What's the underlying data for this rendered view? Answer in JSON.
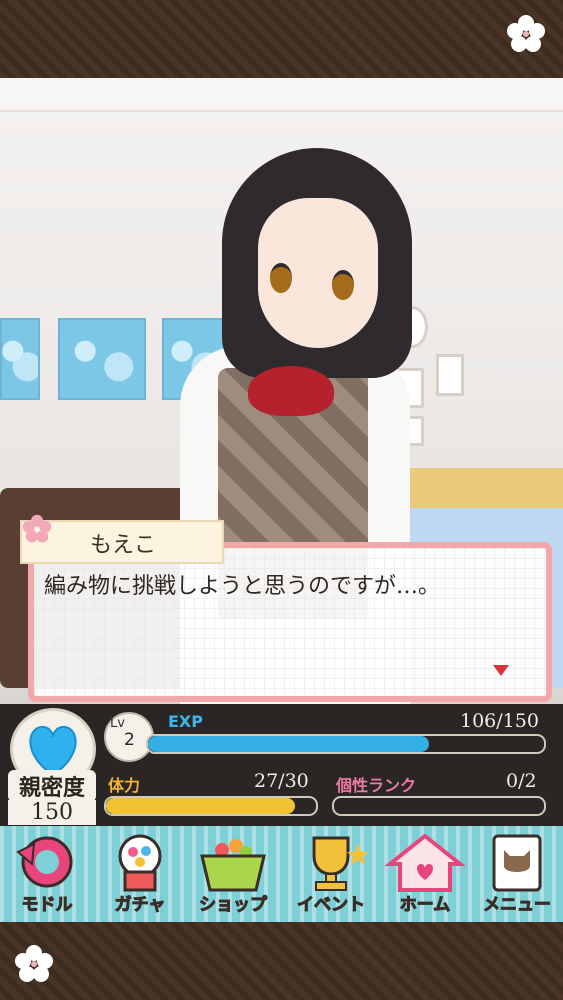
{
  "dialog": {
    "speaker": "もえこ",
    "text": "編み物に挑戦しようと思うのですが…。"
  },
  "status": {
    "affinity_label": "親密度",
    "affinity_value": "150",
    "level_label": "Lv",
    "level_value": "2",
    "exp_label": "EXP",
    "exp_value": "106/150",
    "exp_progress": 0.71,
    "stamina_label": "体力",
    "stamina_value": "27/30",
    "stamina_progress": 0.9,
    "rank_label": "個性ランク",
    "rank_value": "0/2",
    "rank_progress": 0
  },
  "menu": {
    "items": [
      {
        "label": "モドル",
        "icon": "back-arrow-icon"
      },
      {
        "label": "ガチャ",
        "icon": "gacha-machine-icon"
      },
      {
        "label": "ショップ",
        "icon": "shop-basket-icon"
      },
      {
        "label": "イベント",
        "icon": "trophy-icon"
      },
      {
        "label": "ホーム",
        "icon": "house-icon"
      },
      {
        "label": "メニュー",
        "icon": "cat-card-icon"
      }
    ]
  },
  "colors": {
    "exp_bar": "#35aee4",
    "stamina_bar": "#f1c232",
    "dialog_border": "#f2a8a8",
    "menu_bg": "#7fd0d6"
  }
}
